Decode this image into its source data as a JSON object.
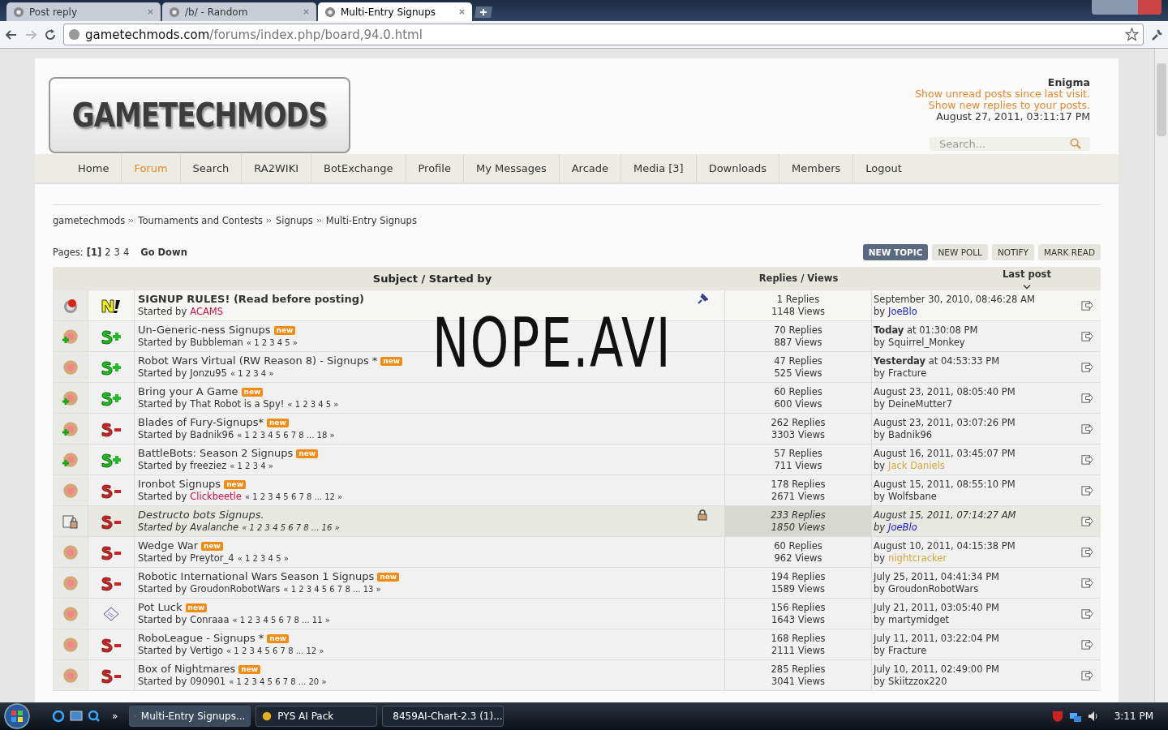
{
  "browser": {
    "tabs": [
      {
        "title": "Post reply",
        "selected": false
      },
      {
        "title": "/b/ - Random",
        "selected": false
      },
      {
        "title": "Multi-Entry Signups",
        "selected": true
      }
    ],
    "address": {
      "host": "gametechmods.com",
      "path": "/forums/index.php/board,94.0.html"
    }
  },
  "header": {
    "logo": "GAMETECHMODS",
    "user": "Enigma",
    "links": [
      "Show unread posts since last visit.",
      "Show new replies to your posts."
    ],
    "date": "August 27, 2011, 03:11:17 PM",
    "search_placeholder": "Search..."
  },
  "nav": [
    {
      "label": "Home",
      "selected": false
    },
    {
      "label": "Forum",
      "selected": true
    },
    {
      "label": "Search",
      "selected": false
    },
    {
      "label": "RA2WIKI",
      "selected": false
    },
    {
      "label": "BotExchange",
      "selected": false
    },
    {
      "label": "Profile",
      "selected": false
    },
    {
      "label": "My Messages",
      "selected": false
    },
    {
      "label": "Arcade",
      "selected": false
    },
    {
      "label": "Media [3]",
      "selected": false
    },
    {
      "label": "Downloads",
      "selected": false
    },
    {
      "label": "Members",
      "selected": false
    },
    {
      "label": "Logout",
      "selected": false
    }
  ],
  "breadcrumb": [
    "gametechmods",
    "Tournaments and Contests",
    "Signups",
    "Multi-Entry Signups"
  ],
  "pages": {
    "label": "Pages:",
    "items": [
      {
        "label": "[1]",
        "selected": true
      },
      {
        "label": "2",
        "selected": false
      },
      {
        "label": "3",
        "selected": false
      },
      {
        "label": "4",
        "selected": false
      }
    ],
    "go_down": "Go Down"
  },
  "actions": [
    {
      "label": "NEW TOPIC",
      "primary": true
    },
    {
      "label": "NEW POLL",
      "primary": false
    },
    {
      "label": "NOTIFY",
      "primary": false
    },
    {
      "label": "MARK READ",
      "primary": false
    }
  ],
  "columns": {
    "subject": "Subject / Started by",
    "stats": "Replies / Views",
    "last": "Last post"
  },
  "overlay_text": "NOPE.AVI",
  "rows": [
    {
      "kind": "rules",
      "sticky": true,
      "locked": false,
      "subject": "SIGNUP RULES! (Read before posting)",
      "started_label": "Started by",
      "starter": {
        "name": "ACAMS",
        "color": "#cc1144"
      },
      "pages": "",
      "replies": "1 Replies",
      "views": "1148 Views",
      "last_date": "September 30, 2010, 08:46:28 AM",
      "by_label": "by",
      "last_by": {
        "name": "JoeBlo",
        "color": "#1a1acc"
      }
    },
    {
      "kind": "plus",
      "sticky": false,
      "locked": false,
      "participated": true,
      "subject": "Un-Generic-ness Signups",
      "badge": "new",
      "started_label": "Started by",
      "starter": {
        "name": "Bubbleman"
      },
      "pages": "« 1 2 3 4 5 »",
      "replies": "70 Replies",
      "views": "887 Views",
      "last_date": "**Today** at 01:30:08 PM",
      "by_label": "by",
      "last_by": {
        "name": "Squirrel_Monkey"
      }
    },
    {
      "kind": "plus",
      "sticky": false,
      "locked": false,
      "participated": false,
      "subject": "Robot Wars Virtual (RW Reason 8) - Signups *",
      "badge": "new",
      "started_label": "Started by",
      "starter": {
        "name": "Jonzu95"
      },
      "pages": "« 1 2 3 4 »",
      "replies": "47 Replies",
      "views": "525 Views",
      "last_date": "**Yesterday** at 04:53:33 PM",
      "by_label": "by",
      "last_by": {
        "name": "Fracture"
      }
    },
    {
      "kind": "plus",
      "sticky": false,
      "locked": false,
      "participated": true,
      "subject": "Bring your A Game",
      "badge": "new",
      "started_label": "Started by",
      "starter": {
        "name": "That Robot is a Spy!"
      },
      "pages": "« 1 2 3 4 5 »",
      "replies": "60 Replies",
      "views": "600 Views",
      "last_date": "August 23, 2011, 08:05:40 PM",
      "by_label": "by",
      "last_by": {
        "name": "DeineMutter7"
      }
    },
    {
      "kind": "minus",
      "sticky": false,
      "locked": false,
      "participated": true,
      "subject": "Blades of Fury-Signups*",
      "badge": "new",
      "started_label": "Started by",
      "starter": {
        "name": "Badnik96"
      },
      "pages": "« 1 2 3 4 5 6 7 8 ... 18 »",
      "replies": "262 Replies",
      "views": "3303 Views",
      "last_date": "August 23, 2011, 03:07:26 PM",
      "by_label": "by",
      "last_by": {
        "name": "Badnik96"
      }
    },
    {
      "kind": "plus",
      "sticky": false,
      "locked": false,
      "participated": true,
      "subject": "BattleBots: Season 2 Signups",
      "badge": "new",
      "started_label": "Started by",
      "starter": {
        "name": "freeziez"
      },
      "pages": "« 1 2 3 4 »",
      "replies": "57 Replies",
      "views": "711 Views",
      "last_date": "August 16, 2011, 03:45:07 PM",
      "by_label": "by",
      "last_by": {
        "name": "Jack Daniels",
        "color": "#d4a838"
      }
    },
    {
      "kind": "minus",
      "sticky": false,
      "locked": false,
      "participated": false,
      "subject": "Ironbot Signups",
      "badge": "new",
      "started_label": "Started by",
      "starter": {
        "name": "Clickbeetle",
        "color": "#cc1144"
      },
      "pages": "« 1 2 3 4 5 6 7 8 ... 12 »",
      "replies": "178 Replies",
      "views": "2671 Views",
      "last_date": "August 15, 2011, 08:55:10 PM",
      "by_label": "by",
      "last_by": {
        "name": "Wolfsbane"
      }
    },
    {
      "kind": "minus",
      "sticky": false,
      "locked": true,
      "subject": "Destructo bots Signups.",
      "started_label": "Started by",
      "starter": {
        "name": "Avalanche"
      },
      "pages": "« 1 2 3 4 5 6 7 8 ... 16 »",
      "replies": "233 Replies",
      "views": "1850 Views",
      "last_date": "August 15, 2011, 07:14:27 AM",
      "by_label": "by",
      "last_by": {
        "name": "JoeBlo",
        "color": "#1a1acc"
      }
    },
    {
      "kind": "minus",
      "sticky": false,
      "locked": false,
      "participated": false,
      "subject": "Wedge War",
      "badge": "new",
      "started_label": "Started by",
      "starter": {
        "name": "Preytor_4"
      },
      "pages": "« 1 2 3 4 5 »",
      "replies": "60 Replies",
      "views": "962 Views",
      "last_date": "August 10, 2011, 04:15:38 PM",
      "by_label": "by",
      "last_by": {
        "name": "nightcracker",
        "color": "#d4a838"
      }
    },
    {
      "kind": "minus",
      "sticky": false,
      "locked": false,
      "participated": false,
      "subject": "Robotic International Wars Season 1 Signups",
      "badge": "new",
      "started_label": "Started by",
      "starter": {
        "name": "GroudonRobotWars"
      },
      "pages": "« 1 2 3 4 5 6 7 8 ... 13 »",
      "replies": "194 Replies",
      "views": "1589 Views",
      "last_date": "July 25, 2011, 04:41:34 PM",
      "by_label": "by",
      "last_by": {
        "name": "GroudonRobotWars"
      }
    },
    {
      "kind": "poll",
      "sticky": false,
      "locked": false,
      "participated": false,
      "subject": "Pot Luck",
      "badge": "new",
      "started_label": "Started by",
      "starter": {
        "name": "Conraaa"
      },
      "pages": "« 1 2 3 4 5 6 7 8 ... 11 »",
      "replies": "156 Replies",
      "views": "1643 Views",
      "last_date": "July 21, 2011, 03:05:40 PM",
      "by_label": "by",
      "last_by": {
        "name": "martymidget"
      }
    },
    {
      "kind": "minus",
      "sticky": false,
      "locked": false,
      "participated": false,
      "subject": "RoboLeague - Signups *",
      "badge": "new",
      "started_label": "Started by",
      "starter": {
        "name": "Vertigo"
      },
      "pages": "« 1 2 3 4 5 6 7 8 ... 12 »",
      "replies": "168 Replies",
      "views": "2111 Views",
      "last_date": "July 11, 2011, 03:22:04 PM",
      "by_label": "by",
      "last_by": {
        "name": "Fracture"
      }
    },
    {
      "kind": "minus",
      "sticky": false,
      "locked": false,
      "participated": false,
      "subject": "Box of Nightmares",
      "badge": "new",
      "started_label": "Started by",
      "starter": {
        "name": "090901"
      },
      "pages": "« 1 2 3 4 5 6 7 8 ... 20 »",
      "replies": "285 Replies",
      "views": "3041 Views",
      "last_date": "July 10, 2011, 02:49:00 PM",
      "by_label": "by",
      "last_by": {
        "name": "Skiitzzox220"
      }
    }
  ],
  "taskbar": {
    "expand": "»",
    "buttons": [
      {
        "label": "Multi-Entry Signups...",
        "selected": true
      },
      {
        "label": "PYS AI Pack",
        "selected": false
      },
      {
        "label": "8459AI-Chart-2.3 (1)...",
        "selected": false
      }
    ],
    "clock": "3:11 PM"
  }
}
